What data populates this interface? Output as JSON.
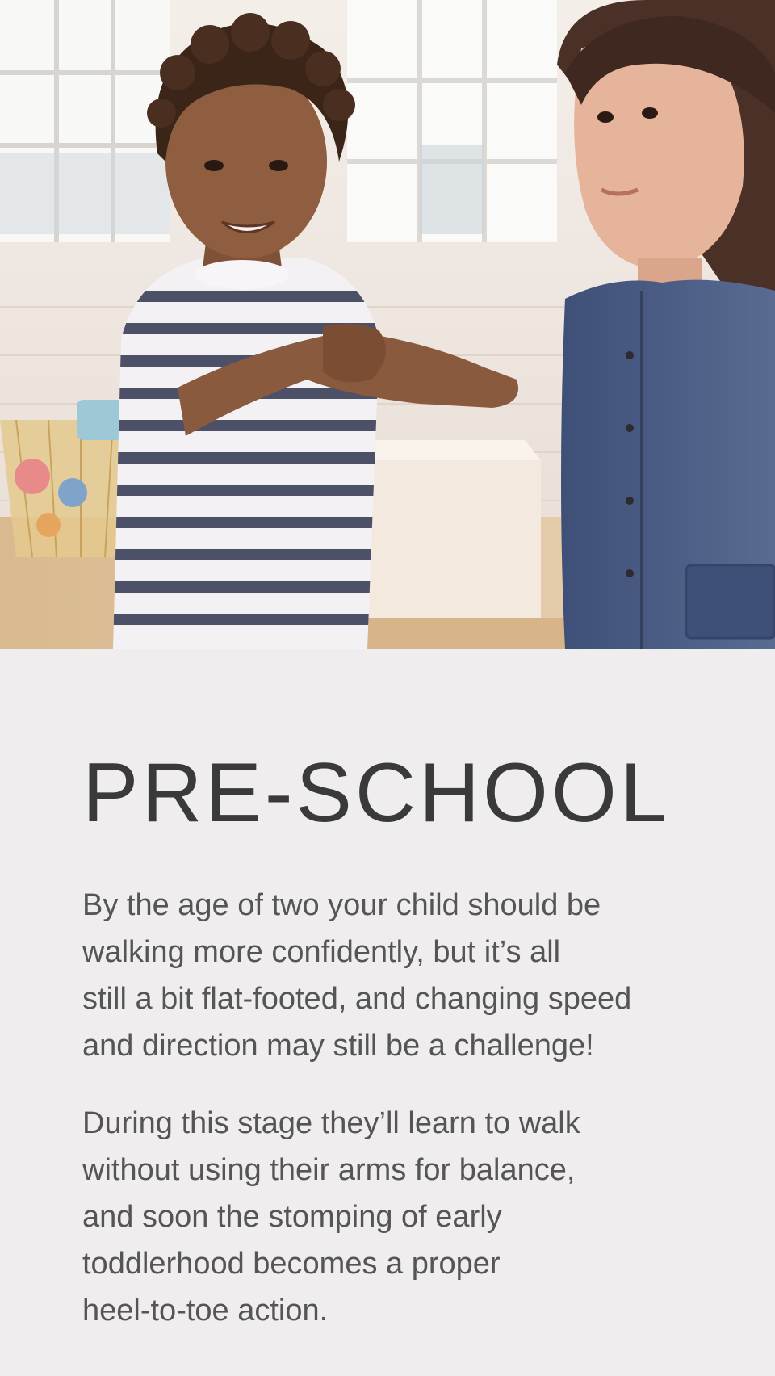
{
  "hero": {
    "image_subject": "two toddlers in a playroom, one in a striped top, one in a blue cardigan"
  },
  "article": {
    "title": "PRE-SCHOOL",
    "paragraph_1": "By the age of two your child should be\nwalking more confidently, but it’s all\nstill a bit flat-footed, and changing speed\nand direction may still be a challenge!",
    "paragraph_2": "During this stage they’ll learn to walk\nwithout using their arms for balance,\nand soon the stomping of early\ntoddlerhood becomes a proper\nheel-to-toe action."
  },
  "colors": {
    "background": "#efedee",
    "title": "#3a3a3a",
    "body_text": "#555557"
  }
}
